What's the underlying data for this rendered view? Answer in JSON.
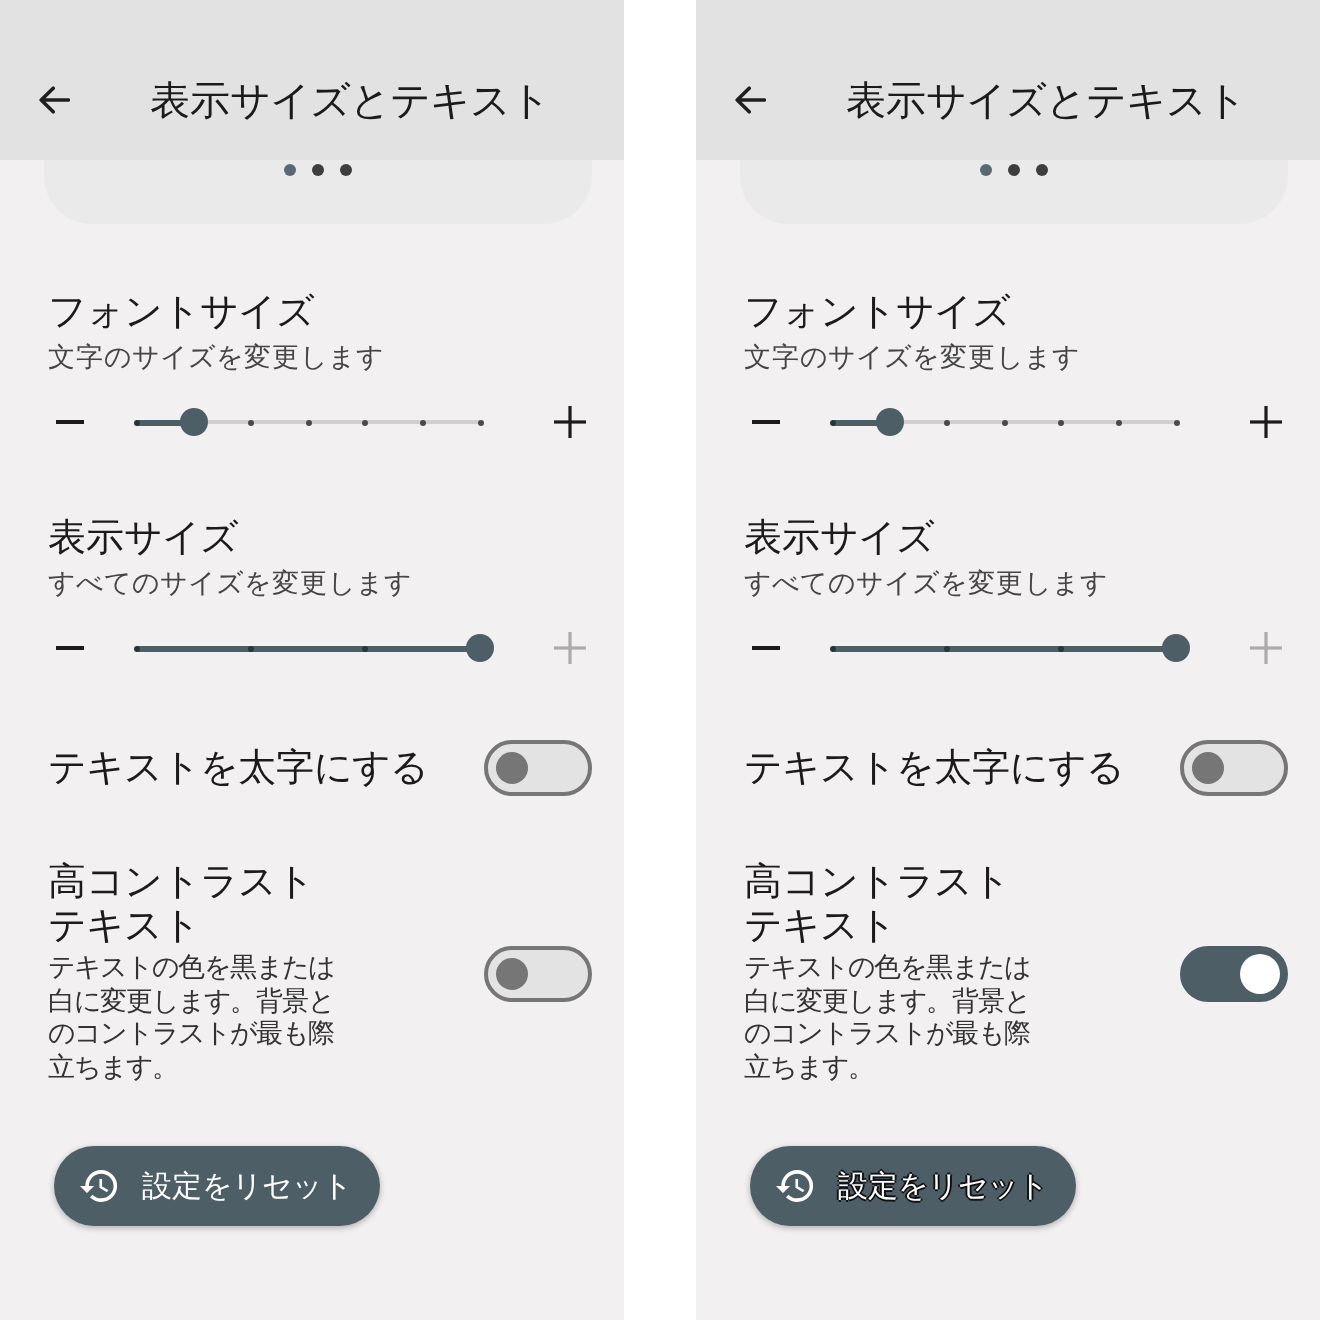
{
  "screens": [
    {
      "top_bar": {
        "title": "表示サイズとテキスト"
      },
      "preview_pager": [
        {
          "selected": true
        },
        {
          "selected": false
        },
        {
          "selected": false
        }
      ],
      "settings": [
        {
          "kind": "slider",
          "title": "フォントサイズ",
          "subtitle": "文字のサイズを変更します",
          "level": 0.1667,
          "stops": [
            {
              "kind": "tick"
            },
            {
              "kind": "tick"
            },
            {
              "kind": "tick"
            },
            {
              "kind": "tick"
            },
            {
              "kind": "tick"
            },
            {
              "kind": "tick"
            },
            {
              "kind": "tick"
            }
          ],
          "decrease": {
            "disabled": false
          },
          "increase": {
            "disabled": false
          }
        },
        {
          "kind": "slider",
          "title": "表示サイズ",
          "subtitle": "すべてのサイズを変更します",
          "level": 1,
          "stops": [
            {
              "kind": "tick"
            },
            {
              "kind": "tick"
            },
            {
              "kind": "tick"
            },
            {
              "kind": "tick"
            }
          ],
          "decrease": {
            "disabled": false
          },
          "increase": {
            "disabled": true
          }
        },
        {
          "kind": "toggle",
          "title": "テキストを太字にする",
          "on": false
        },
        {
          "kind": "toggle",
          "title": "高コントラストテキスト",
          "description": "テキストの色を黒または白に変更します。背景とのコントラストが最も際立ちます。",
          "on": false
        }
      ],
      "reset_button": {
        "label": "設定をリセット",
        "outlined": false
      }
    },
    {
      "top_bar": {
        "title": "表示サイズとテキスト"
      },
      "preview_pager": [
        {
          "selected": true
        },
        {
          "selected": false
        },
        {
          "selected": false
        }
      ],
      "settings": [
        {
          "kind": "slider",
          "title": "フォントサイズ",
          "subtitle": "文字のサイズを変更します",
          "level": 0.1667,
          "stops": [
            {
              "kind": "tick"
            },
            {
              "kind": "tick"
            },
            {
              "kind": "tick"
            },
            {
              "kind": "tick"
            },
            {
              "kind": "tick"
            },
            {
              "kind": "tick"
            },
            {
              "kind": "tick"
            }
          ],
          "decrease": {
            "disabled": false
          },
          "increase": {
            "disabled": false
          }
        },
        {
          "kind": "slider",
          "title": "表示サイズ",
          "subtitle": "すべてのサイズを変更します",
          "level": 1,
          "stops": [
            {
              "kind": "tick"
            },
            {
              "kind": "tick"
            },
            {
              "kind": "tick"
            },
            {
              "kind": "tick"
            }
          ],
          "decrease": {
            "disabled": false
          },
          "increase": {
            "disabled": true
          }
        },
        {
          "kind": "toggle",
          "title": "テキストを太字にする",
          "on": false
        },
        {
          "kind": "toggle",
          "title": "高コントラストテキスト",
          "description": "テキストの色を黒または白に変更します。背景とのコントラストが最も際立ちます。",
          "on": true
        }
      ],
      "reset_button": {
        "label": "設定をリセット",
        "outlined": true
      }
    }
  ]
}
